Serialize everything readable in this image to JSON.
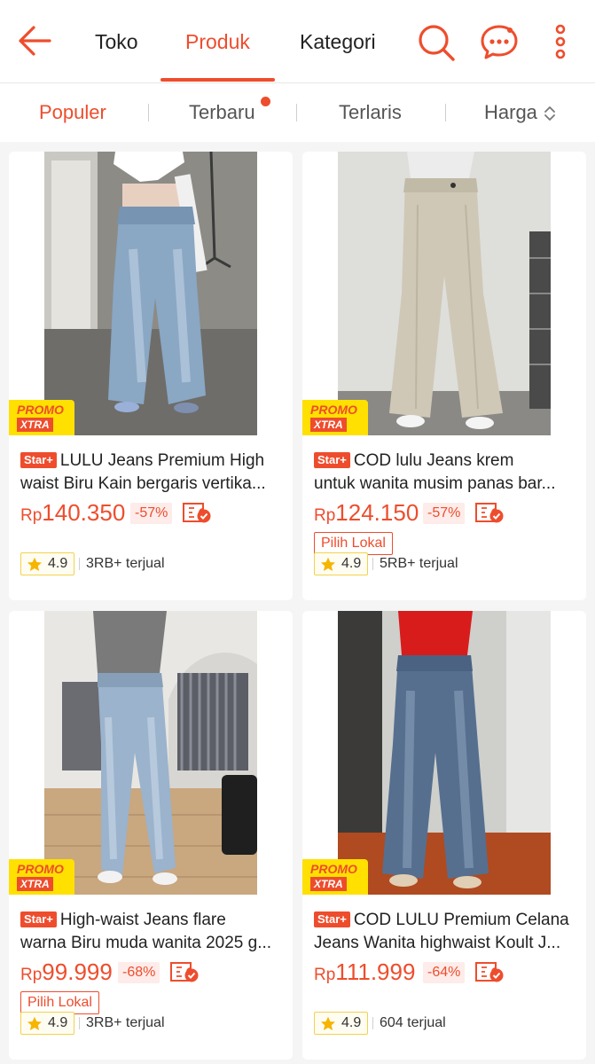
{
  "header": {
    "tabs": [
      {
        "label": "Toko"
      },
      {
        "label": "Produk",
        "active": true
      },
      {
        "label": "Kategori"
      }
    ],
    "icons": [
      "back-arrow-icon",
      "search-icon",
      "chat-icon",
      "more-vertical-icon"
    ]
  },
  "sort": {
    "items": [
      {
        "label": "Populer",
        "active": true
      },
      {
        "label": "Terbaru",
        "has_new_dot": true
      },
      {
        "label": "Terlaris"
      },
      {
        "label": "Harga",
        "icon": "sort-updown-icon"
      }
    ]
  },
  "promo": {
    "line1": "PROMO",
    "line2": "XTRA"
  },
  "badge_label": "Star+",
  "currency": "Rp",
  "products": [
    {
      "title_line1": "LULU Jeans Premium High",
      "title_line2": "waist Biru Kain bergaris vertika...",
      "price": "140.350",
      "discount": "-57%",
      "pilih_lokal": "",
      "rating": "4.9",
      "sold": "3RB+ terjual"
    },
    {
      "title_line1": "COD lulu Jeans krem",
      "title_line2": "untuk wanita musim panas bar...",
      "price": "124.150",
      "discount": "-57%",
      "pilih_lokal": "Pilih Lokal",
      "rating": "4.9",
      "sold": "5RB+ terjual"
    },
    {
      "title_line1": "High-waist Jeans flare",
      "title_line2": "warna Biru muda wanita 2025 g...",
      "price": "99.999",
      "discount": "-68%",
      "pilih_lokal": "Pilih Lokal",
      "rating": "4.9",
      "sold": "3RB+ terjual"
    },
    {
      "title_line1": "COD LULU Premium Celana",
      "title_line2": "Jeans Wanita highwaist Koult J...",
      "price": "111.999",
      "discount": "-64%",
      "pilih_lokal": "",
      "rating": "4.9",
      "sold": "604 terjual"
    }
  ],
  "colors": {
    "accent": "#ee4d2d",
    "promo_yellow": "#ffe000",
    "rating_star": "#f6b500"
  }
}
